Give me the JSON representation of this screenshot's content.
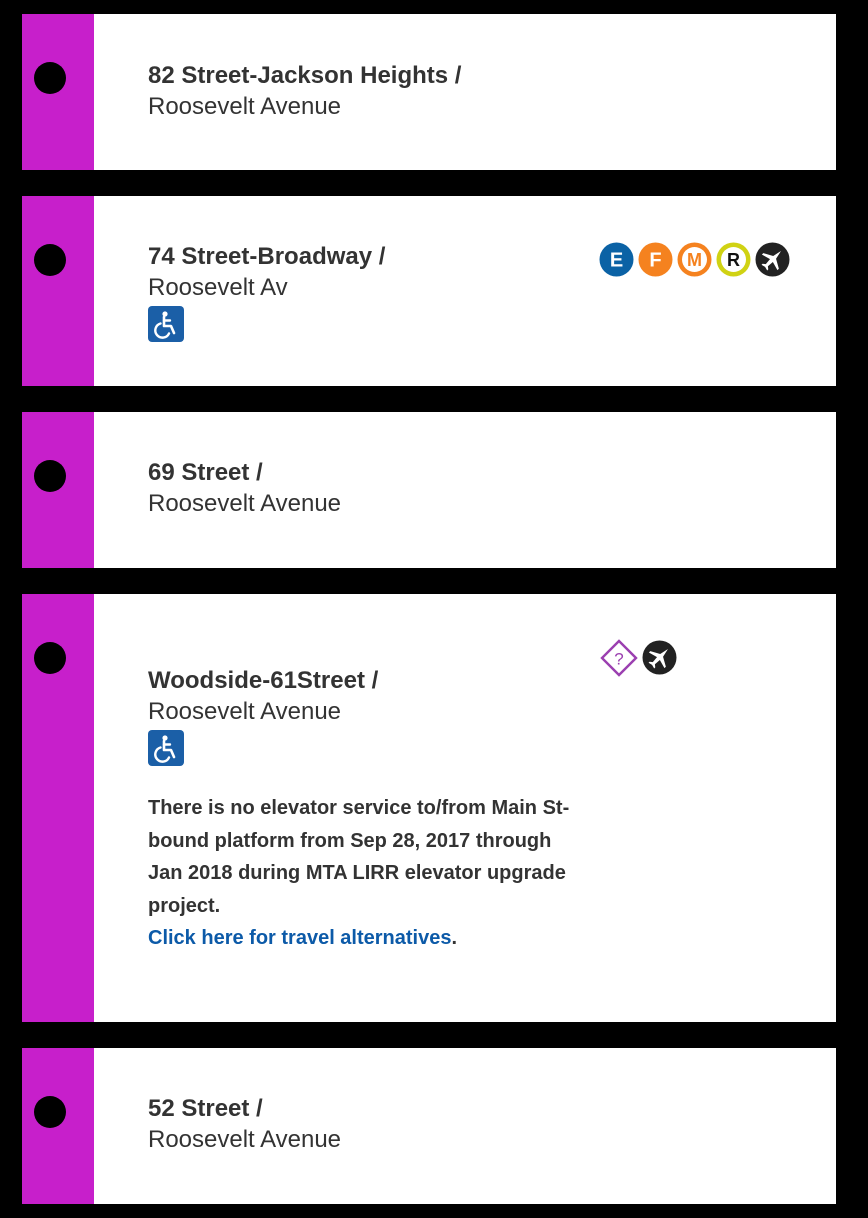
{
  "colors": {
    "line": "#c71fcb",
    "background": "#000000",
    "panel": "#ffffff",
    "text": "#333333",
    "link": "#0c5aa8",
    "accessibility": "#1b5fa7",
    "route_E": "#0b62a5",
    "route_F": "#f5821f",
    "route_M": "#f5821f",
    "route_R": "#d0d213",
    "airport": "#222222",
    "bus_stop": "#9b3fb0"
  },
  "stations": [
    {
      "name": "82 Street-Jackson Heights /",
      "street": "Roosevelt Avenue"
    },
    {
      "name": "74 Street-Broadway /",
      "street": "Roosevelt Av",
      "accessibility_icon": "wheelchair-accessible-icon",
      "transfers": [
        {
          "label": "E",
          "icon": "route-e-icon",
          "style": "solid"
        },
        {
          "label": "F",
          "icon": "route-f-icon",
          "style": "solid"
        },
        {
          "label": "M",
          "icon": "route-m-icon",
          "style": "outlined"
        },
        {
          "label": "R",
          "icon": "route-r-icon",
          "style": "outlined"
        },
        {
          "label": "",
          "icon": "airport-icon",
          "style": "solid"
        }
      ]
    },
    {
      "name": "69 Street /",
      "street": "Roosevelt Avenue"
    },
    {
      "name": "Woodside-61Street /",
      "street": "Roosevelt Avenue",
      "accessibility_icon": "wheelchair-accessible-icon",
      "notice": "There is no elevator service to/from Main St-bound platform from Sep 28, 2017 through Jan 2018 during MTA LIRR elevator upgrade project.",
      "notice_link": "Click here for travel alternatives",
      "notice_link_suffix": ".",
      "transfers": [
        {
          "label": "?",
          "icon": "bus-stop-diamond-icon",
          "style": "outlined"
        },
        {
          "label": "",
          "icon": "airport-icon",
          "style": "solid"
        }
      ]
    },
    {
      "name": "52 Street /",
      "street": "Roosevelt Avenue"
    }
  ]
}
